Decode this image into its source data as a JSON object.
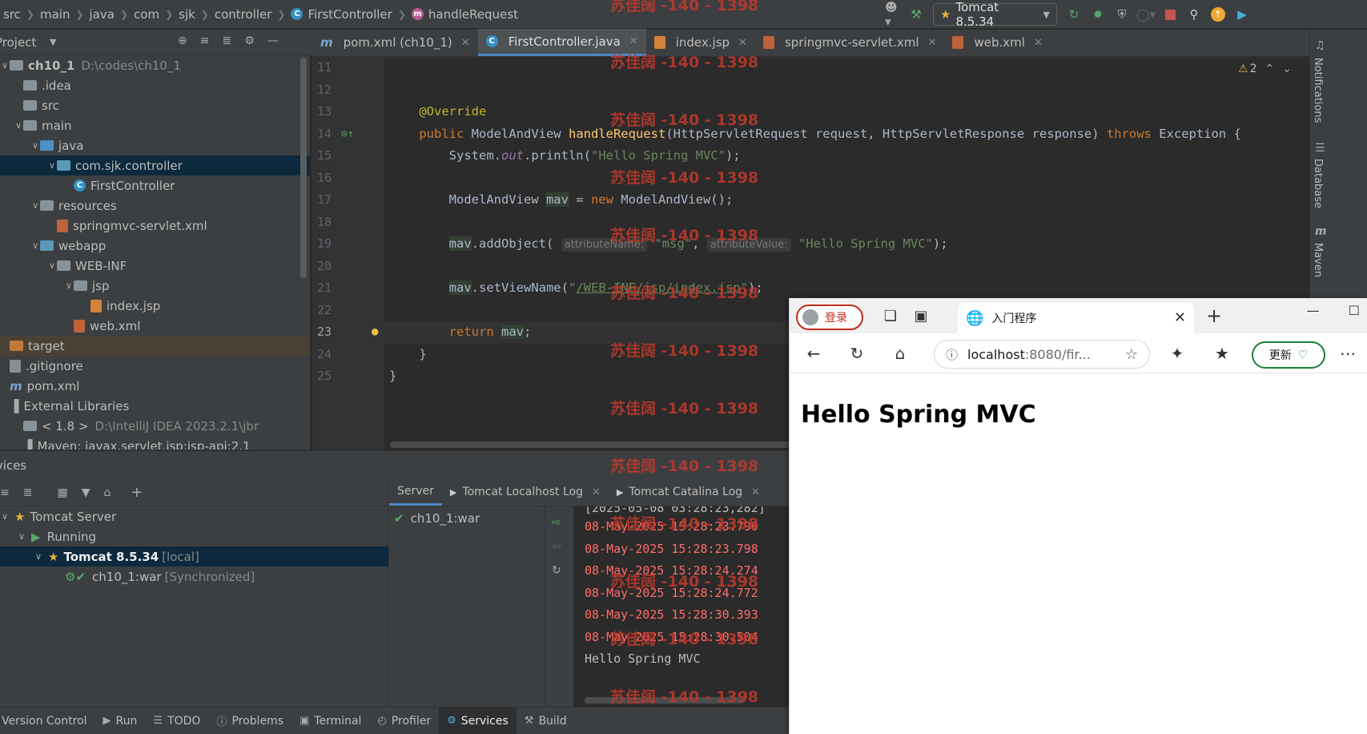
{
  "breadcrumb": [
    "src",
    "main",
    "java",
    "com",
    "sjk",
    "controller",
    "FirstController",
    "handleRequest"
  ],
  "run_config": "Tomcat 8.5.34",
  "project": {
    "title": "Project",
    "tree": [
      {
        "label": "ch10_1",
        "path": "D:\\codes\\ch10_1",
        "level": 0,
        "arrow": "v",
        "icon": "module-folder-icon"
      },
      {
        "label": ".idea",
        "level": 1,
        "arrow": ">",
        "icon": "folder-icon"
      },
      {
        "label": "src",
        "level": 1,
        "arrow": "",
        "icon": "folder-icon"
      },
      {
        "label": "main",
        "level": 1,
        "arrow": "v",
        "icon": "folder-icon"
      },
      {
        "label": "java",
        "level": 2,
        "arrow": "v",
        "icon": "source-folder-icon"
      },
      {
        "label": "com.sjk.controller",
        "level": 3,
        "arrow": "v",
        "icon": "package-icon"
      },
      {
        "label": "FirstController",
        "level": 4,
        "arrow": "",
        "icon": "class-icon"
      },
      {
        "label": "resources",
        "level": 2,
        "arrow": "v",
        "icon": "resources-folder-icon"
      },
      {
        "label": "springmvc-servlet.xml",
        "level": 3,
        "arrow": "",
        "icon": "xml-file-icon"
      },
      {
        "label": "webapp",
        "level": 2,
        "arrow": "v",
        "icon": "web-folder-icon"
      },
      {
        "label": "WEB-INF",
        "level": 3,
        "arrow": "v",
        "icon": "folder-icon"
      },
      {
        "label": "jsp",
        "level": 4,
        "arrow": "v",
        "icon": "folder-icon"
      },
      {
        "label": "index.jsp",
        "level": 5,
        "arrow": "",
        "icon": "jsp-file-icon"
      },
      {
        "label": "web.xml",
        "level": 4,
        "arrow": "",
        "icon": "xml-file-icon"
      },
      {
        "label": "target",
        "level": 0,
        "arrow": "",
        "icon": "excluded-folder-icon"
      },
      {
        "label": ".gitignore",
        "level": 0,
        "arrow": "",
        "icon": "text-file-icon"
      },
      {
        "label": "pom.xml",
        "level": 0,
        "arrow": "",
        "icon": "maven-icon"
      },
      {
        "label": "External Libraries",
        "level": 0,
        "arrow": "",
        "icon": "library-icon"
      },
      {
        "label": "< 1.8 >",
        "path": "D:\\IntelliJ IDEA 2023.2.1\\jbr",
        "level": 1,
        "arrow": "",
        "icon": "jdk-icon"
      },
      {
        "label": "Maven: javax.servlet.jsp:jsp-api:2.1",
        "level": 1,
        "arrow": "",
        "icon": "library-icon"
      }
    ]
  },
  "editor": {
    "tabs": [
      {
        "label": "pom.xml (ch10_1)",
        "icon": "maven-icon",
        "active": false
      },
      {
        "label": "FirstController.java",
        "icon": "class-icon",
        "active": true
      },
      {
        "label": "index.jsp",
        "icon": "jsp-file-icon",
        "active": false
      },
      {
        "label": "springmvc-servlet.xml",
        "icon": "xml-file-icon",
        "active": false
      },
      {
        "label": "web.xml",
        "icon": "xml-file-icon",
        "active": false
      }
    ],
    "line_numbers": [
      "11",
      "12",
      "13",
      "14",
      "15",
      "16",
      "17",
      "18",
      "19",
      "20",
      "21",
      "22",
      "23",
      "24",
      "25"
    ],
    "current_line": "23",
    "warnings": "2"
  },
  "side_tools": [
    "Notifications",
    "Database",
    "Maven"
  ],
  "services": {
    "title": "Services",
    "tree": [
      {
        "label": "Tomcat Server",
        "level": 1,
        "arrow": "v"
      },
      {
        "label": "Running",
        "level": 2,
        "arrow": "v"
      },
      {
        "label": "Tomcat 8.5.34",
        "suffix": "[local]",
        "level": 3,
        "arrow": "v"
      },
      {
        "label": "ch10_1:war",
        "suffix": "[Synchronized]",
        "level": 4,
        "arrow": ""
      }
    ],
    "tabs": [
      "Server",
      "Tomcat Localhost Log",
      "Tomcat Catalina Log"
    ],
    "deployment": "ch10_1:war",
    "log_lines": [
      {
        "text": "[2025-05-08 03:28:23,282]",
        "error": false
      },
      {
        "text": "08-May-2025 15:28:23.790",
        "error": true
      },
      {
        "text": "08-May-2025 15:28:23.798",
        "error": true
      },
      {
        "text": "08-May-2025 15:28:24.274",
        "error": true
      },
      {
        "text": "08-May-2025 15:28:24.772",
        "error": true
      },
      {
        "text": "08-May-2025 15:28:30.393",
        "error": true
      },
      {
        "text": "08-May-2025 15:28:30.504",
        "error": true
      },
      {
        "text": "Hello Spring MVC",
        "error": false
      }
    ]
  },
  "bottom_bar": [
    {
      "label": "Version Control",
      "icon": "vcs-icon",
      "active": false
    },
    {
      "label": "Run",
      "icon": "run-icon",
      "active": false
    },
    {
      "label": "TODO",
      "icon": "todo-icon",
      "active": false
    },
    {
      "label": "Problems",
      "icon": "problems-icon",
      "active": false
    },
    {
      "label": "Terminal",
      "icon": "terminal-icon",
      "active": false
    },
    {
      "label": "Profiler",
      "icon": "profiler-icon",
      "active": false
    },
    {
      "label": "Services",
      "icon": "services-icon",
      "active": true
    },
    {
      "label": "Build",
      "icon": "build-icon",
      "active": false
    }
  ],
  "watermark": "苏佳阔 -140 - 1398",
  "browser": {
    "profile_label": "登录",
    "tab_title": "入门程序",
    "address_host": "localhost",
    "address_rest": ":8080/fir...",
    "update_label": "更新",
    "page_heading": "Hello Spring MVC"
  },
  "colors": {
    "accent": "#4a88c7",
    "error_log": "#ff6b68",
    "watermark": "#c0392b"
  }
}
